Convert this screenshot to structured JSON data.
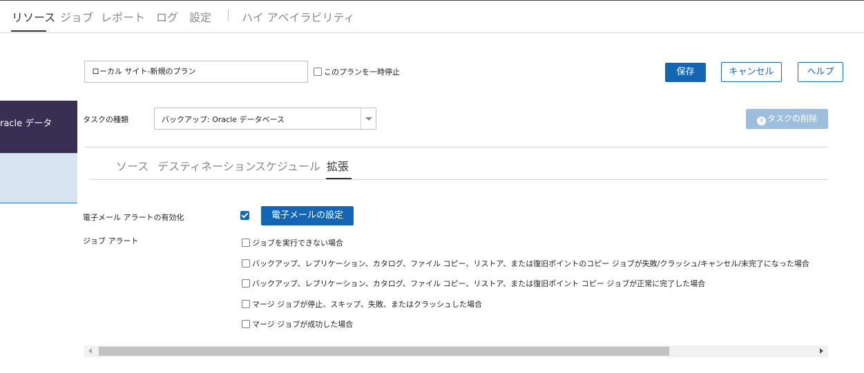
{
  "nav": {
    "items": [
      "リソース",
      "ジョブ",
      "レポート",
      "ログ",
      "設定"
    ],
    "ha": "ハイ アベイラビリティ"
  },
  "plan": {
    "name": "ローカル サイト-新規のプラン",
    "pause_label": "このプランを一時停止",
    "save": "保存",
    "cancel": "キャンセル",
    "help": "ヘルプ"
  },
  "sidebar": {
    "task_name": "racle データ"
  },
  "task": {
    "type_label": "タスクの種類",
    "type_value": "バックアップ: Oracle データベース",
    "delete": "タスクの削除",
    "delete_icon": "x-circle-icon"
  },
  "tabs": [
    "ソース",
    "デスティネーション",
    "スケジュール",
    "拡張"
  ],
  "extended": {
    "email_alert_label": "電子メール アラートの有効化",
    "email_alert_checked": true,
    "email_settings": "電子メールの設定",
    "job_alert_label": "ジョブ アラート",
    "alerts": [
      "ジョブを実行できない場合",
      "バックアップ、レプリケーション、カタログ、ファイル コピー、リストア、または復旧ポイントのコピー ジョブが失敗/クラッシュ/キャンセル/未完了になった場合",
      "バックアップ、レプリケーション、カタログ、ファイル コピー、リストア、または復旧ポイント コピー ジョブが正常に完了した場合",
      "マージ ジョブが停止、スキップ、失敗、またはクラッシュした場合",
      "マージ ジョブが成功した場合"
    ]
  },
  "colors": {
    "accent": "#1466b2",
    "sidebar_dark": "#3a2f52",
    "sidebar_light": "#d8e4f1"
  }
}
